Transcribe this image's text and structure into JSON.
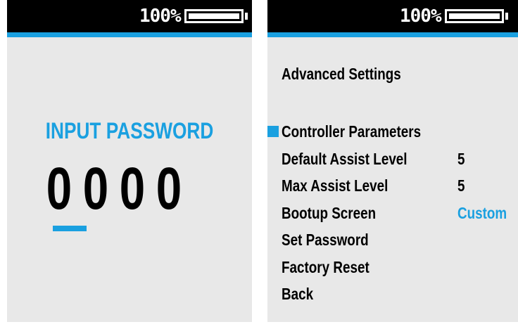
{
  "colors": {
    "accent": "#1aa0e0",
    "status_bar": "#000000",
    "screen_background": "#e8e8e8",
    "text": "#000000"
  },
  "left_screen": {
    "status": {
      "battery_percent": "100%",
      "battery_level": 1.0
    },
    "password_prompt": "INPUT PASSWORD",
    "digits": [
      "0",
      "0",
      "0",
      "0"
    ],
    "active_digit_index": 0
  },
  "right_screen": {
    "status": {
      "battery_percent": "100%",
      "battery_level": 1.0
    },
    "heading": "Advanced Settings",
    "menu": [
      {
        "label": "Controller Parameters",
        "value": "",
        "selected": true
      },
      {
        "label": "Default Assist Level",
        "value": "5",
        "selected": false
      },
      {
        "label": "Max Assist Level",
        "value": "5",
        "selected": false
      },
      {
        "label": "Bootup Screen",
        "value": "Custom",
        "selected": false
      },
      {
        "label": "Set Password",
        "value": "",
        "selected": false
      },
      {
        "label": "Factory Reset",
        "value": "",
        "selected": false
      },
      {
        "label": "Back",
        "value": "",
        "selected": false
      }
    ]
  },
  "icons": {
    "battery": "battery-icon",
    "selector": "selector-square-icon"
  }
}
